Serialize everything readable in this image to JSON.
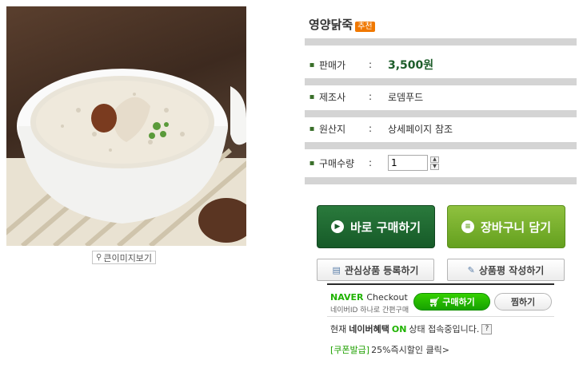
{
  "product": {
    "name": "영양닭죽",
    "badge": "추천",
    "zoom_label": "큰이미지보기",
    "image_icon": "map-pin-icon"
  },
  "info": {
    "price": {
      "label": "판매가",
      "sep": ":",
      "value": "3,500원"
    },
    "maker": {
      "label": "제조사",
      "sep": ":",
      "value": "로뎀푸드"
    },
    "origin": {
      "label": "원산지",
      "sep": ":",
      "value": "상세페이지 참조"
    },
    "quantity": {
      "label": "구매수량",
      "sep": ":",
      "value": "1"
    },
    "bullet": "▪"
  },
  "actions": {
    "buy_now": "바로 구매하기",
    "add_cart": "장바구니 담기",
    "wishlist": "관심상품 등록하기",
    "review": "상품평 작성하기"
  },
  "naver": {
    "brand": "NAVER",
    "checkout": "Checkout",
    "sub": "네이버ID 하나로 간편구매",
    "buy_label": "구매하기",
    "zzim_label": "찜하기",
    "status_prefix": "현재",
    "status_brand": "네이버혜택",
    "status_on": "ON",
    "status_suffix": "상태 접속중입니다.",
    "help": "?"
  },
  "coupon": {
    "tag": "[쿠폰발급]",
    "text": "25%즉시할인 클릭>"
  },
  "colors": {
    "buy_green": "#165a28",
    "cart_green": "#64a01e",
    "naver_green": "#1fb300",
    "badge_orange": "#f07800"
  }
}
